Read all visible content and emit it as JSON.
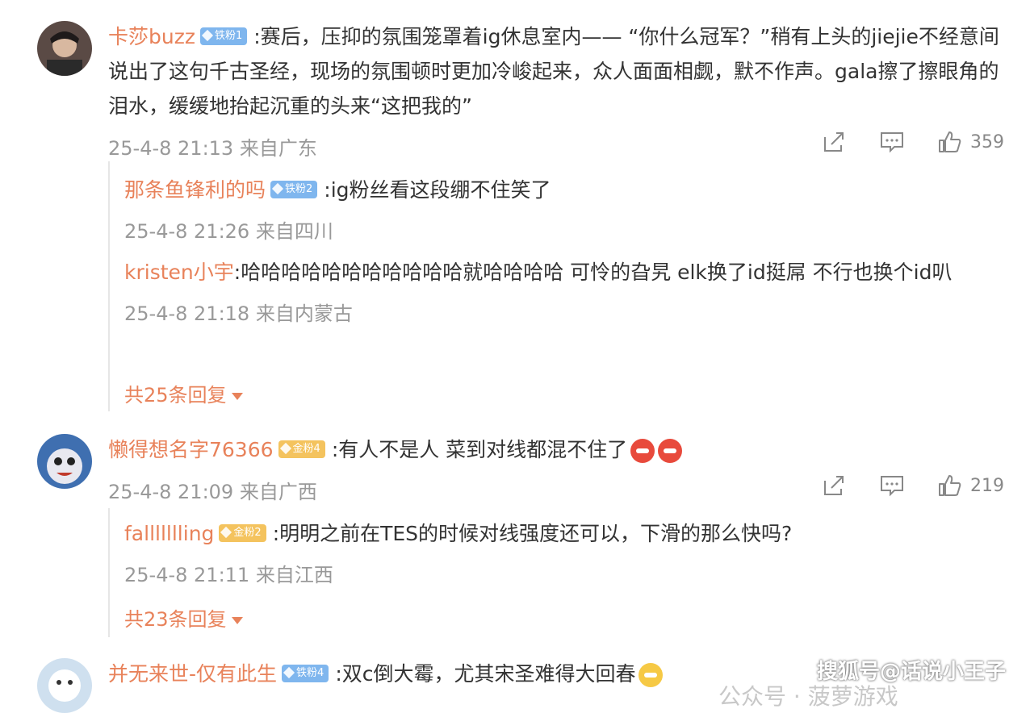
{
  "comments": [
    {
      "username": "卡莎buzz",
      "badge": "铁粉1",
      "text": ":赛后，压抑的氛围笼罩着ig休息室内—— “你什么冠军？”稍有上头的jiejie不经意间说出了这句千古圣经，现场的氛围顿时更加冷峻起来，众人面面相觑，默不作声。gala擦了擦眼角的泪水，缓缓地抬起沉重的头来“这把我的”",
      "meta": "25-4-8 21:13 来自广东",
      "likes": "359",
      "replies": [
        {
          "username": "那条鱼锋利的吗",
          "badge": "铁粉2",
          "text": ":ig粉丝看这段绷不住笑了",
          "meta": "25-4-8 21:26 来自四川"
        },
        {
          "username": "kristen小宇",
          "badge": "",
          "text": ":哈哈哈哈哈哈哈哈哈哈哈就哈哈哈哈 可怜的旮旯 elk换了id挺屌 不行也换个id叭",
          "meta": "25-4-8 21:18 来自内蒙古"
        }
      ],
      "more_replies": "共25条回复"
    },
    {
      "username": "懒得想名字76366",
      "badge": "金粉4",
      "text": ":有人不是人 菜到对线都混不住了",
      "meta": "25-4-8 21:09 来自广西",
      "likes": "219",
      "replies": [
        {
          "username": "fallllllling",
          "badge": "金粉2",
          "text": ":明明之前在TES的时候对线强度还可以，下滑的那么快吗?",
          "meta": "25-4-8 21:11 来自江西"
        }
      ],
      "more_replies": "共23条回复"
    },
    {
      "username": "并无来世-仅有此生",
      "badge": "铁粉4",
      "text": ":双c倒大霉，尤其宋圣难得大回春"
    }
  ],
  "watermark": "搜狐号@话说小王子",
  "faded_footer": "公众号 · 菠萝游戏",
  "icons": [
    "share-icon",
    "comment-icon",
    "like-icon"
  ],
  "colors": {
    "username": "#e8825a",
    "meta": "#999999",
    "badge_blue": "#7fb6ee",
    "badge_gold": "#f4c35e"
  }
}
